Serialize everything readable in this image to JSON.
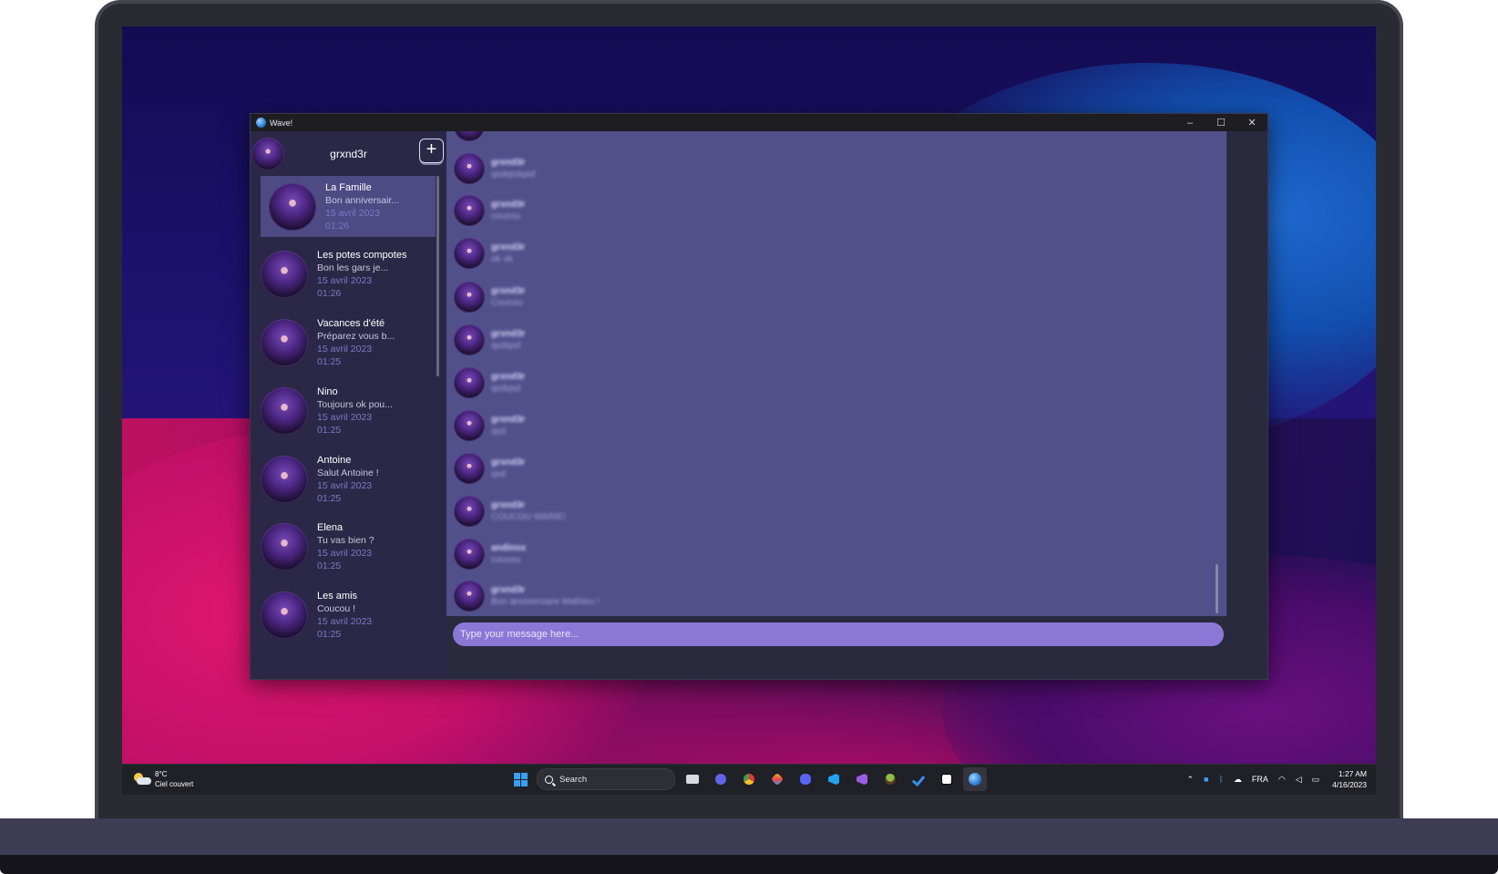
{
  "window": {
    "title": "Wave!",
    "minimize": "–",
    "maximize": "☐",
    "close": "✕"
  },
  "user": {
    "name": "grxnd3r",
    "new_conversation_label": "+"
  },
  "conversations": [
    {
      "name": "La Famille",
      "preview": "Bon anniversair...",
      "date": "15 avril 2023",
      "time": "01:26",
      "active": true
    },
    {
      "name": "Les potes compotes",
      "preview": "Bon les gars je...",
      "date": "15 avril 2023",
      "time": "01:26"
    },
    {
      "name": "Vacances d'été",
      "preview": "Préparez vous b...",
      "date": "15 avril 2023",
      "time": "01:25"
    },
    {
      "name": "Nino",
      "preview": "Toujours ok pou...",
      "date": "15 avril 2023",
      "time": "01:25"
    },
    {
      "name": "Antoine",
      "preview": "Salut Antoine !",
      "date": "15 avril 2023",
      "time": "01:25"
    },
    {
      "name": "Elena",
      "preview": "Tu vas bien ?",
      "date": "15 avril 2023",
      "time": "01:25"
    },
    {
      "name": "Les amis",
      "preview": "Coucou !",
      "date": "15 avril 2023",
      "time": "01:25"
    }
  ],
  "messages": [
    {
      "author": "grxnd3r",
      "text": "qsdqsdqsd"
    },
    {
      "author": "grxnd3r",
      "text": "coucou"
    },
    {
      "author": "grxnd3r",
      "text": "ok ok"
    },
    {
      "author": "grxnd3r",
      "text": "Coucou"
    },
    {
      "author": "grxnd3r",
      "text": "qsdqsd"
    },
    {
      "author": "grxnd3r",
      "text": "qsdqsd"
    },
    {
      "author": "grxnd3r",
      "text": "qsd"
    },
    {
      "author": "grxnd3r",
      "text": "qsd"
    },
    {
      "author": "grxnd3r",
      "text": "COUCOU MARIE!"
    },
    {
      "author": "andinox",
      "text": "coucou"
    },
    {
      "author": "grxnd3r",
      "text": "Bon anniversaire Mathieu !"
    }
  ],
  "composer": {
    "placeholder": "Type your message here..."
  },
  "taskbar": {
    "weather_temp": "8°C",
    "weather_desc": "Ciel couvert",
    "search_label": "Search",
    "language": "FRA",
    "time": "1:27 AM",
    "date": "4/16/2023"
  },
  "colors": {
    "sidebar_bg": "#2a2846",
    "active_conversation": "#4d4a84",
    "chat_bg": "#51508a",
    "composer_bg": "#8b78d6",
    "date_text": "#7d78c8"
  },
  "icons": {
    "taskbar": [
      "windows-start-icon",
      "search-icon",
      "task-view-icon",
      "teams-chat-icon",
      "chrome-icon",
      "git-icon",
      "discord-icon",
      "vscode-icon",
      "visual-studio-icon",
      "tree-app-icon",
      "todo-icon",
      "notion-icon",
      "wave-app-icon"
    ],
    "tray": [
      "chevron-up-icon",
      "security-icon",
      "bluetooth-icon",
      "onedrive-icon",
      "wifi-icon",
      "volume-icon",
      "battery-icon"
    ]
  }
}
